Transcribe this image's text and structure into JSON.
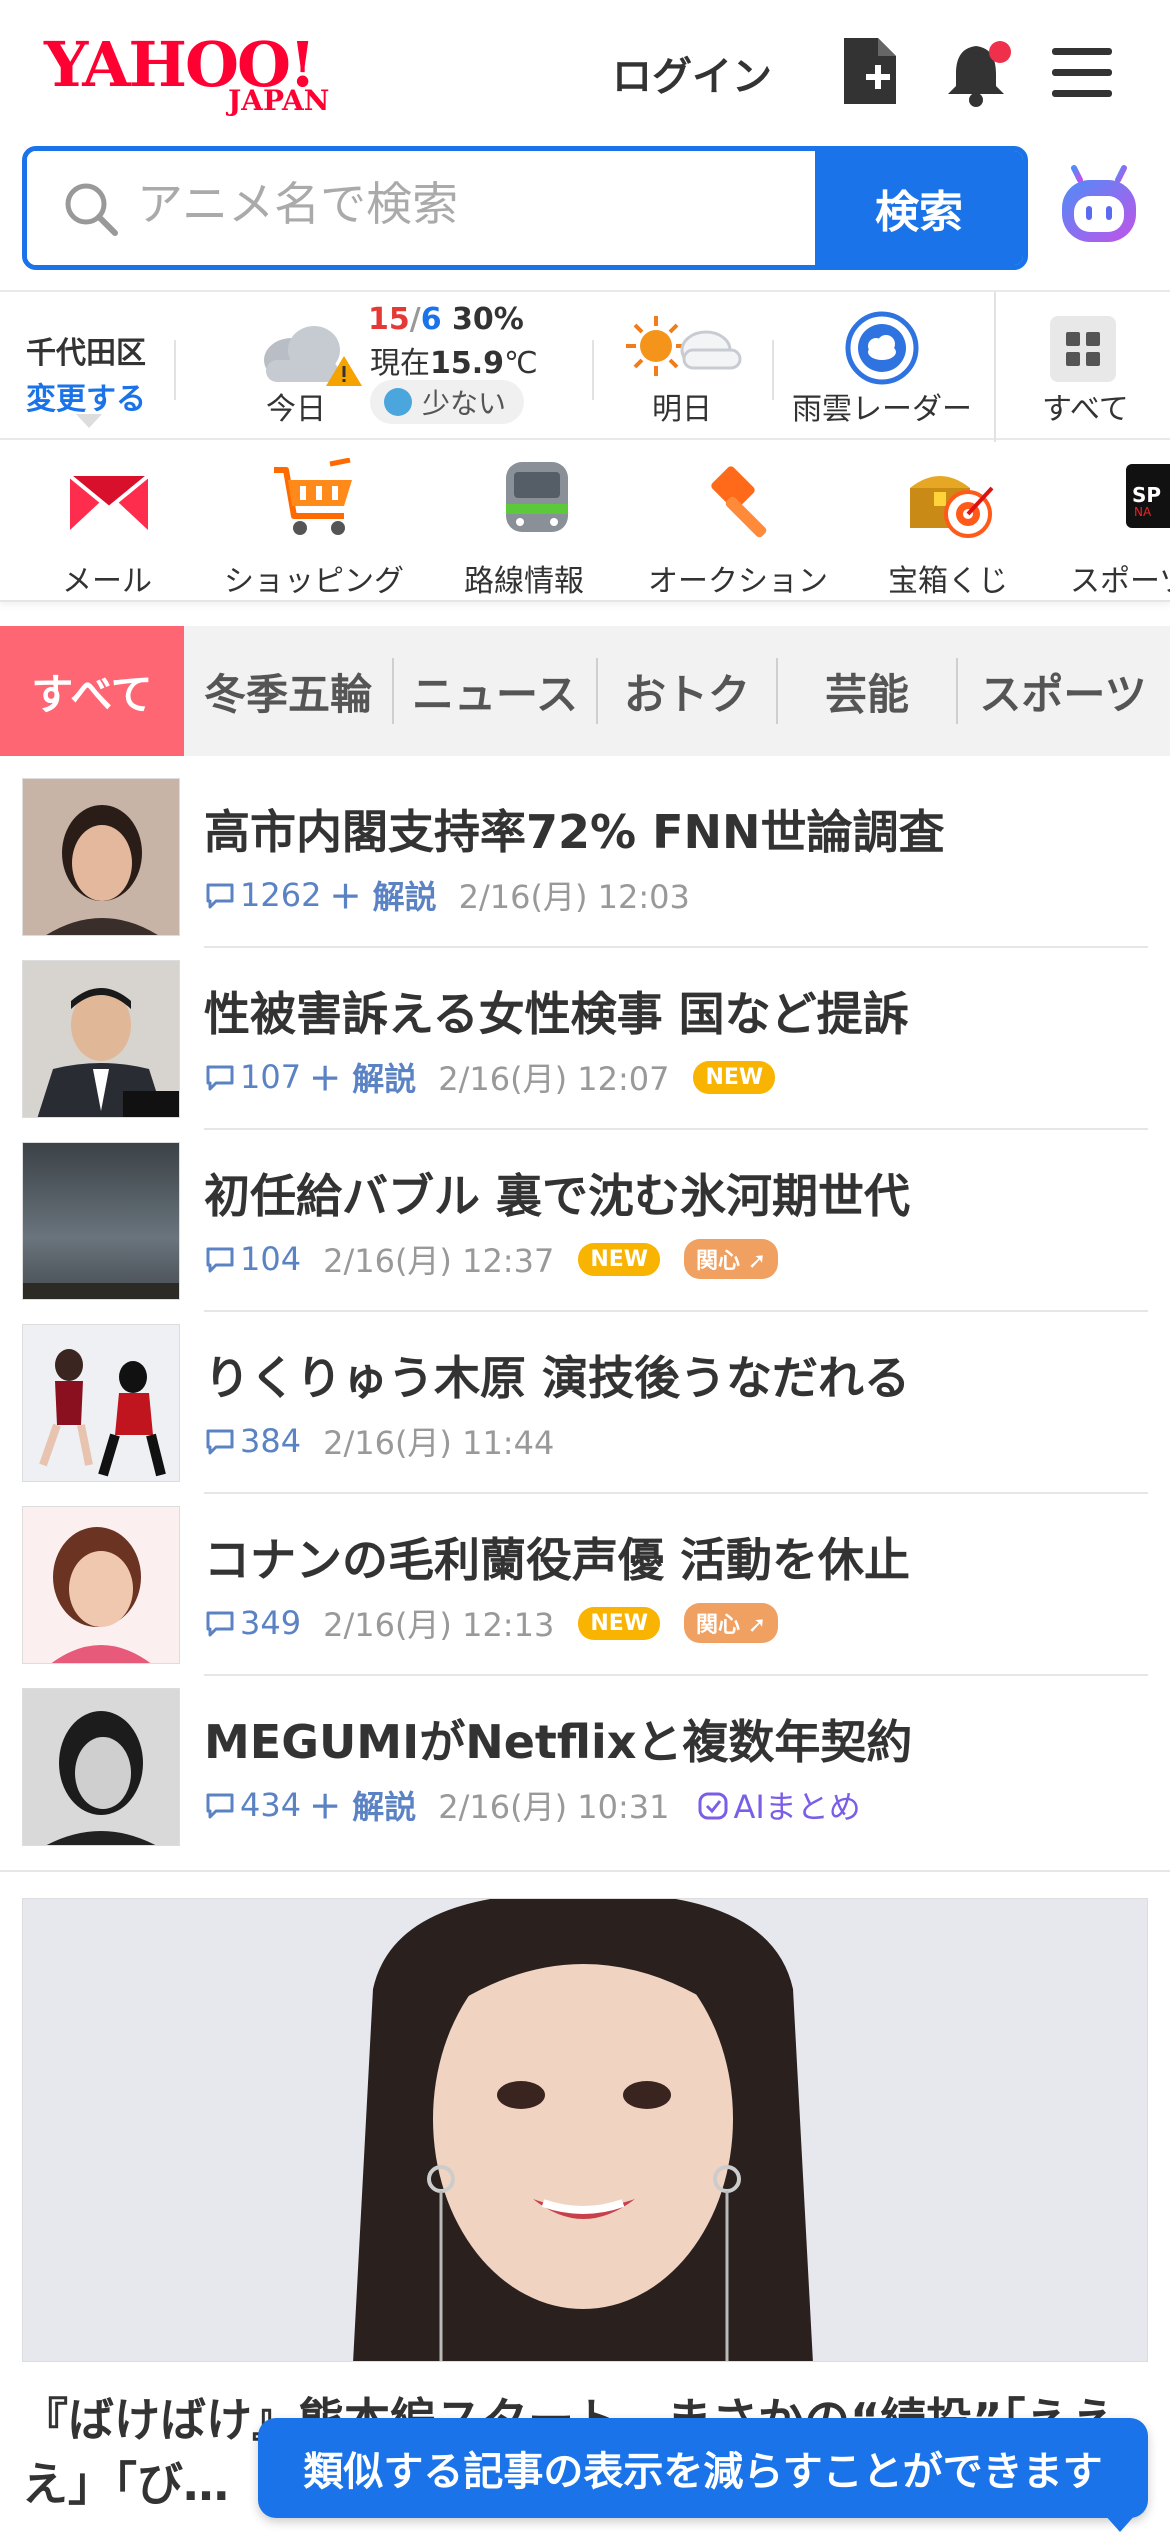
{
  "header": {
    "logo_text": "YAHOO!",
    "logo_sub": "JAPAN",
    "login_label": "ログイン",
    "icons": [
      "document-add-icon",
      "bell-icon",
      "menu-icon"
    ],
    "notification_color": "#f0304a"
  },
  "search": {
    "placeholder": "アニメ名で検索",
    "button_label": "検索",
    "accent": "#1a73e8"
  },
  "weather": {
    "location": "千代田区",
    "change_label": "変更する",
    "today_label": "今日",
    "temp_high": "15",
    "temp_sep": "/",
    "temp_low": "6",
    "rain_chance": "30%",
    "current_prefix": "現在",
    "current_temp": "15.9",
    "current_unit": "℃",
    "pollen": "少ない",
    "tomorrow_label": "明日",
    "radar_label": "雨雲レーダー",
    "all_label": "すべて"
  },
  "services": [
    {
      "label": "メール",
      "icon": "mail-icon"
    },
    {
      "label": "ショッピング",
      "icon": "shopping-cart-icon"
    },
    {
      "label": "路線情報",
      "icon": "train-icon"
    },
    {
      "label": "オークション",
      "icon": "auction-hammer-icon"
    },
    {
      "label": "宝箱くじ",
      "icon": "treasure-box-icon"
    },
    {
      "label": "スポーツ",
      "icon": "sports-icon"
    }
  ],
  "tabs": [
    {
      "label": "すべて",
      "active": true
    },
    {
      "label": "冬季五輪"
    },
    {
      "label": "ニュース"
    },
    {
      "label": "おトク"
    },
    {
      "label": "芸能"
    },
    {
      "label": "スポーツ"
    }
  ],
  "news": [
    {
      "title": "高市内閣支持率72% FNN世論調査",
      "comments": "1262",
      "kaisetsu": "＋ 解説",
      "time": "2/16(月) 12:03"
    },
    {
      "title": "性被害訴える女性検事 国など提訴",
      "comments": "107",
      "kaisetsu": "＋ 解説",
      "time": "2/16(月) 12:07",
      "badge_new": "NEW"
    },
    {
      "title": "初任給バブル 裏で沈む氷河期世代",
      "comments": "104",
      "time": "2/16(月) 12:37",
      "badge_new": "NEW",
      "badge_kanshin": "関心"
    },
    {
      "title": "りくりゅう木原 演技後うなだれる",
      "comments": "384",
      "time": "2/16(月) 11:44"
    },
    {
      "title": "コナンの毛利蘭役声優 活動を休止",
      "comments": "349",
      "time": "2/16(月) 12:13",
      "badge_new": "NEW",
      "badge_kanshin": "関心"
    },
    {
      "title": "MEGUMIがNetflixと複数年契約",
      "comments": "434",
      "kaisetsu": "＋ 解説",
      "time": "2/16(月) 10:31",
      "ai_label": "AIまとめ"
    }
  ],
  "feature": {
    "title": "『ばけばけ』熊本編スタート…まさかの“続投”「えええ」「び…"
  },
  "toast": {
    "message": "類似する記事の表示を減らすことができます"
  }
}
